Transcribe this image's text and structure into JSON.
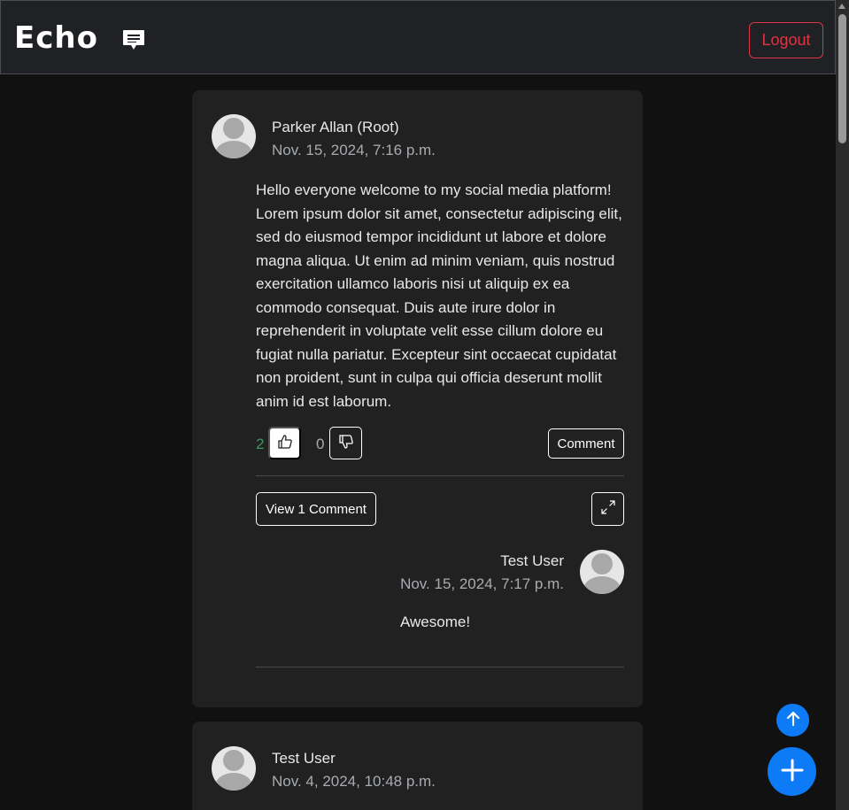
{
  "navbar": {
    "brand": "Echo",
    "brand_icon": "chat-bubble-icon",
    "logout_label": "Logout"
  },
  "posts": [
    {
      "author": "Parker Allan (Root)",
      "timestamp": "Nov. 15, 2024, 7:16 p.m.",
      "body": "Hello everyone welcome to my social media platform! Lorem ipsum dolor sit amet, consectetur adipiscing elit, sed do eiusmod tempor incididunt ut labore et dolore magna aliqua. Ut enim ad minim veniam, quis nostrud exercitation ullamco laboris nisi ut aliquip ex ea commodo consequat. Duis aute irure dolor in reprehenderit in voluptate velit esse cillum dolore eu fugiat nulla pariatur. Excepteur sint occaecat cupidatat non proident, sunt in culpa qui officia deserunt mollit anim id est laborum.",
      "likes": "2",
      "dislikes": "0",
      "comment_label": "Comment",
      "view_comments_label": "View 1 Comment",
      "comments": [
        {
          "author": "Test User",
          "timestamp": "Nov. 15, 2024, 7:17 p.m.",
          "text": "Awesome!"
        }
      ]
    },
    {
      "author": "Test User",
      "timestamp": "Nov. 4, 2024, 10:48 p.m."
    }
  ],
  "colors": {
    "accent": "#0d7bf5",
    "danger": "#dc3545",
    "like": "#3b9a60",
    "card": "#212121",
    "background": "#111111"
  }
}
